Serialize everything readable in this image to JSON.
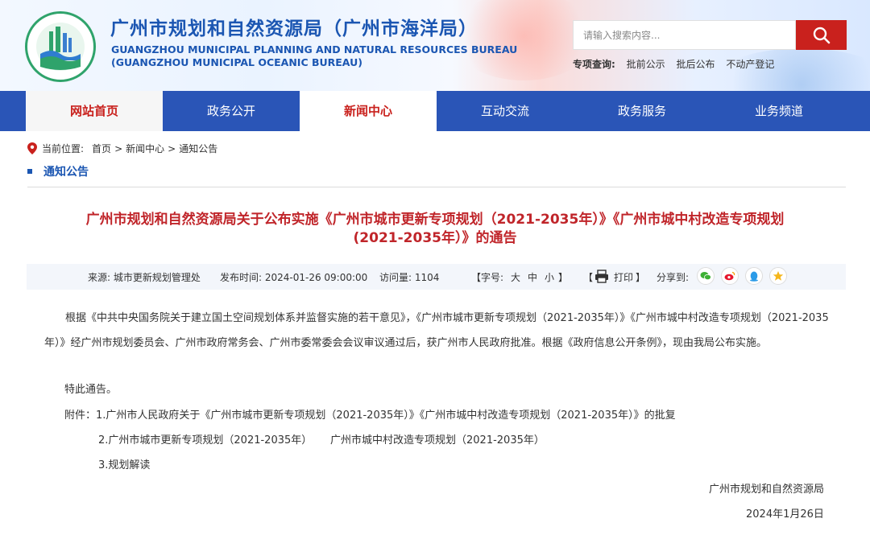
{
  "header": {
    "title_cn": "广州市规划和自然资源局（广州市海洋局）",
    "title_en1": "GUANGZHOU MUNICIPAL PLANNING AND NATURAL RESOURCES BUREAU",
    "title_en2": "(GUANGZHOU MUNICIPAL OCEANIC BUREAU)",
    "search_placeholder": "请输入搜索内容...",
    "special_label": "专项查询:",
    "special_links": [
      "批前公示",
      "批后公布",
      "不动产登记"
    ]
  },
  "nav": [
    "网站首页",
    "政务公开",
    "新闻中心",
    "互动交流",
    "政务服务",
    "业务频道"
  ],
  "breadcrumb": {
    "label": "当前位置:",
    "items": [
      "首页",
      ">",
      "新闻中心",
      ">",
      "通知公告"
    ]
  },
  "section_title": "通知公告",
  "article": {
    "title_line1": "广州市规划和自然资源局关于公布实施《广州市城市更新专项规划（2021-2035年）》《广州市城中村改造专项规划",
    "title_line2": "(2021-2035年）》的通告",
    "meta": {
      "source": "来源:   城市更新规划管理处",
      "time": "发布时间:   2024-01-26 09:00:00",
      "visits": "访问量:      1104",
      "font_label": "【字号:",
      "font_sizes": [
        "大",
        "中",
        "小"
      ],
      "font_close": "】",
      "print_open": "【",
      "print": "打印",
      "print_close": "】",
      "share": "分享到:"
    },
    "para1": "根据《中共中央国务院关于建立国土空间规划体系并监督实施的若干意见》，《广州市城市更新专项规划（2021-2035年）》《广州市城中村改造专项规划（2021-2035年）》经广州市规划委员会、广州市政府常务会、广州市委常委会会议审议通过后，获广州市人民政府批准。根据《政府信息公开条例》，现由我局公布实施。",
    "para2": "特此通告。",
    "attach1": "附件：1.广州市人民政府关于《广州市城市更新专项规划（2021-2035年）》《广州市城中村改造专项规划（2021-2035年）》的批复",
    "attach2a": "2.广州市城市更新专项规划（2021-2035年）",
    "attach2b": "广州市城中村改造专项规划（2021-2035年）",
    "attach3": "3.规划解读",
    "sign": "广州市规划和自然资源局",
    "date": "2024年1月26日"
  },
  "colors": {
    "nav": "#2a55b7",
    "accent_red": "#c9211d",
    "title_blue": "#1b56b2"
  },
  "icons": [
    "logo-emblem",
    "search-icon",
    "location-pin-icon",
    "printer-icon",
    "wechat-icon",
    "weibo-icon",
    "qq-icon",
    "qzone-icon"
  ]
}
